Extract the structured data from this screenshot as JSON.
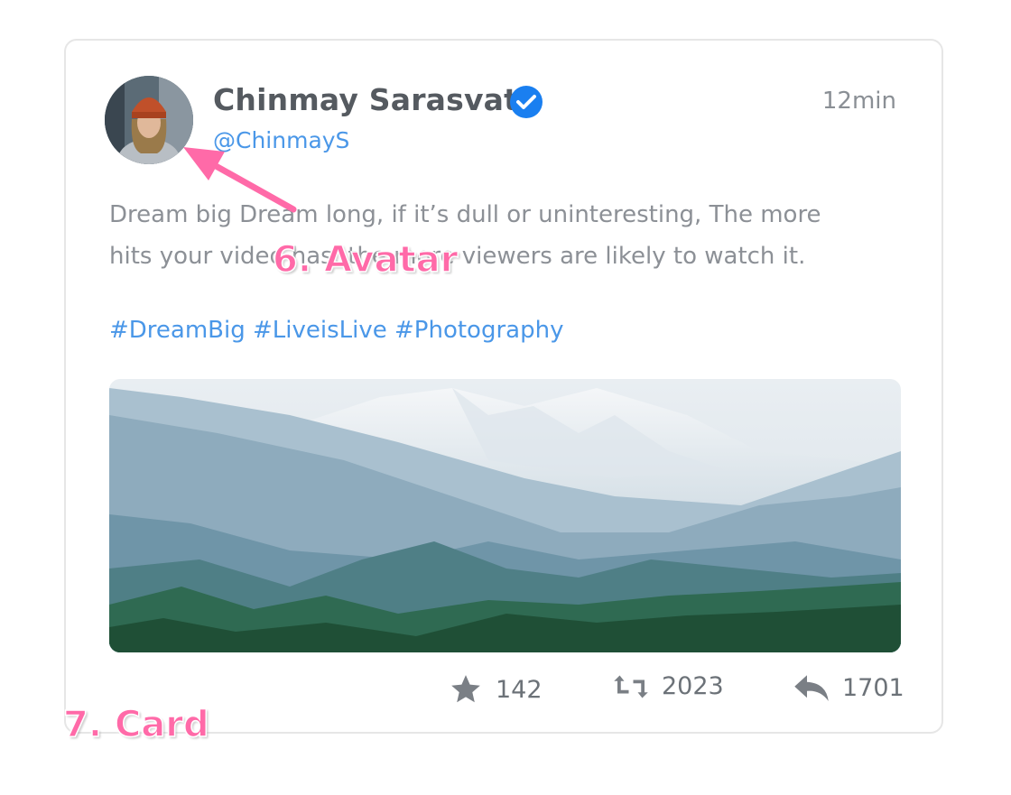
{
  "post": {
    "author_name": "Chinmay Sarasvati",
    "handle": "@ChinmayS",
    "timestamp": "12min",
    "body": "Dream big Dream long, if it’s dull or uninteresting, The more hits your video has, the more viewers are likely to watch it.",
    "hashtags": "#DreamBig #LiveisLive #Photography",
    "photo_icon": "mountain-landscape-photo",
    "verified_color": "#1a7ff0",
    "link_color": "#4a97e8"
  },
  "actions": {
    "favorites": {
      "icon": "star-icon",
      "count": "142"
    },
    "retweets": {
      "icon": "retweet-icon",
      "count": "2023"
    },
    "replies": {
      "icon": "reply-icon",
      "count": "1701"
    }
  },
  "annotations": {
    "avatar_label": "6. Avatar",
    "card_label": "7. Card",
    "color": "#ff6aa8"
  }
}
